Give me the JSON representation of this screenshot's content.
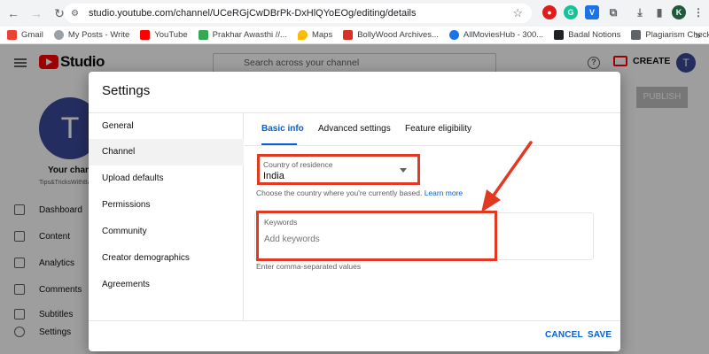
{
  "browser": {
    "url": "studio.youtube.com/channel/UCeRGjCwDBrPk-DxHlQYoEOg/editing/details",
    "profile_initial": "K",
    "bookmarks": [
      "Gmail",
      "My Posts - Write",
      "YouTube",
      "Prakhar Awasthi //...",
      "Maps",
      "BollyWood Archives...",
      "AllMoviesHub - 300...",
      "Badal Notions",
      "Plagiarism Checker..."
    ],
    "more_bookmarks": "»"
  },
  "studio": {
    "logo_text": "Studio",
    "search_placeholder": "Search across your channel",
    "create_label": "CREATE",
    "avatar_initial": "T",
    "channel_name": "Your channel",
    "channel_handle": "Tips&TricksWithBa...",
    "nav": [
      "Dashboard",
      "Content",
      "Analytics",
      "Comments",
      "Subtitles",
      "Settings"
    ],
    "publish_label": "PUBLISH"
  },
  "modal": {
    "title": "Settings",
    "nav": [
      "General",
      "Channel",
      "Upload defaults",
      "Permissions",
      "Community",
      "Creator demographics",
      "Agreements"
    ],
    "active_nav": "Channel",
    "tabs": [
      "Basic info",
      "Advanced settings",
      "Feature eligibility"
    ],
    "country": {
      "label": "Country of residence",
      "value": "India",
      "help": "Choose the country where you're currently based.",
      "learn_more": "Learn more"
    },
    "keywords": {
      "label": "Keywords",
      "placeholder": "Add keywords",
      "help": "Enter comma-separated values"
    },
    "cancel_label": "CANCEL",
    "save_label": "SAVE"
  },
  "colors": {
    "accent": "#065fd4",
    "annotation": "#e23a22",
    "yt_red": "#ff0000"
  }
}
